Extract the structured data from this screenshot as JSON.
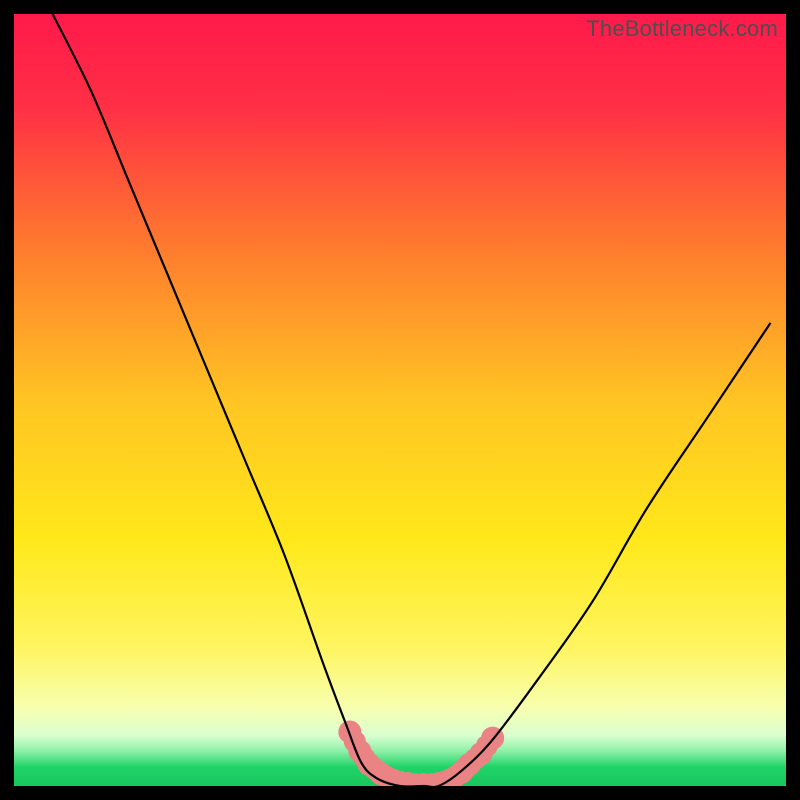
{
  "watermark": "TheBottleneck.com",
  "colors": {
    "frame_bg": "#000000",
    "plot_bg_top": "#ff1a4b",
    "plot_bg_mid": "#ffe000",
    "plot_bg_bottom_band": "#20d468",
    "curve": "#000000",
    "marker": "#ea8383"
  },
  "chart_data": {
    "type": "line",
    "title": "",
    "xlabel": "",
    "ylabel": "",
    "xlim": [
      0,
      100
    ],
    "ylim": [
      0,
      100
    ],
    "series": [
      {
        "name": "bottleneck-curve",
        "x": [
          5,
          10,
          15,
          20,
          25,
          30,
          35,
          40,
          43,
          45,
          47,
          50,
          53,
          55,
          58,
          62,
          68,
          75,
          82,
          90,
          98
        ],
        "y": [
          100,
          90,
          78,
          66,
          54,
          42,
          30,
          16,
          8,
          3,
          1,
          0,
          0,
          0,
          2,
          6,
          14,
          24,
          36,
          48,
          60
        ]
      }
    ],
    "markers": {
      "name": "highlighted-points",
      "x": [
        43.5,
        44.8,
        46.0,
        47.5,
        49.0,
        51.0,
        53.0,
        55.0,
        56.5,
        58.0,
        59.0,
        60.5,
        62.0
      ],
      "y": [
        7.0,
        4.5,
        2.8,
        1.6,
        0.8,
        0.3,
        0.2,
        0.3,
        0.8,
        1.8,
        2.8,
        4.2,
        6.2
      ]
    },
    "gradient_stops": [
      {
        "offset": 0.0,
        "color": "#ff1a4b"
      },
      {
        "offset": 0.12,
        "color": "#ff2f45"
      },
      {
        "offset": 0.3,
        "color": "#ff7a2e"
      },
      {
        "offset": 0.5,
        "color": "#ffc423"
      },
      {
        "offset": 0.68,
        "color": "#ffe81a"
      },
      {
        "offset": 0.82,
        "color": "#fff560"
      },
      {
        "offset": 0.9,
        "color": "#f7ffb0"
      },
      {
        "offset": 0.935,
        "color": "#d9ffcf"
      },
      {
        "offset": 0.955,
        "color": "#8cf0a8"
      },
      {
        "offset": 0.975,
        "color": "#20d468"
      },
      {
        "offset": 1.0,
        "color": "#18c75f"
      }
    ]
  }
}
